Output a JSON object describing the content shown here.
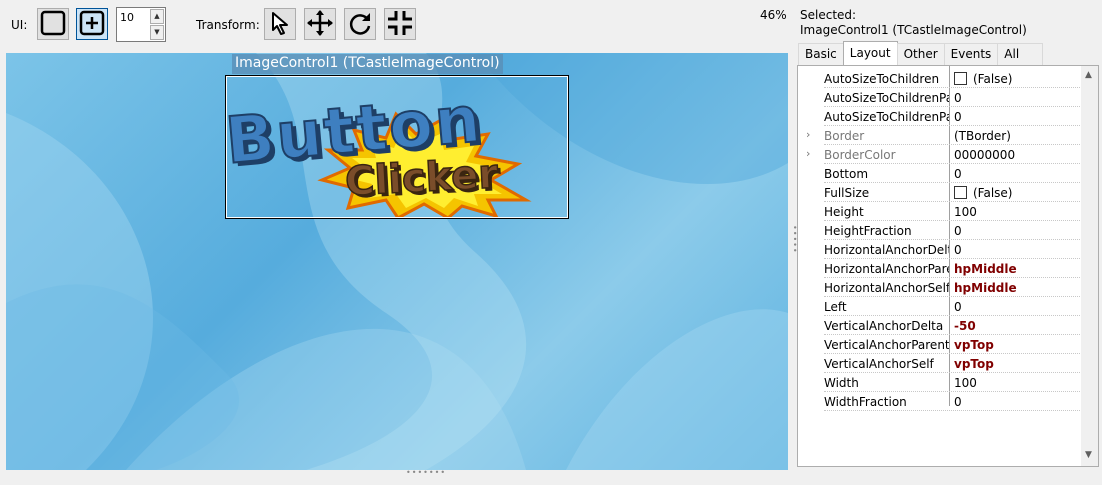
{
  "toolbar": {
    "ui_label": "UI:",
    "spin_value": "10",
    "transform_label": "Transform:",
    "zoom": "46%"
  },
  "viewport": {
    "selection_caption": "ImageControl1 (TCastleImageControl)",
    "image_line1": "Button",
    "image_line2": "Clicker"
  },
  "inspector": {
    "selected_label": "Selected:",
    "selected_value": "ImageControl1 (TCastleImageControl)",
    "tabs": [
      "Basic",
      "Layout",
      "Other",
      "Events",
      "All"
    ],
    "active_tab": "Layout",
    "properties": [
      {
        "name": "AutoSizeToChildren",
        "value": "(False)",
        "checkbox": true
      },
      {
        "name": "AutoSizeToChildrenPaddingRight",
        "value": "0"
      },
      {
        "name": "AutoSizeToChildrenPaddingTop",
        "value": "0"
      },
      {
        "name": "Border",
        "value": "(TBorder)",
        "expandable": true
      },
      {
        "name": "BorderColor",
        "value": "00000000",
        "expandable": true
      },
      {
        "name": "Bottom",
        "value": "0"
      },
      {
        "name": "FullSize",
        "value": "(False)",
        "checkbox": true
      },
      {
        "name": "Height",
        "value": "100"
      },
      {
        "name": "HeightFraction",
        "value": "0"
      },
      {
        "name": "HorizontalAnchorDelta",
        "value": "0"
      },
      {
        "name": "HorizontalAnchorParent",
        "value": "hpMiddle",
        "modified": true
      },
      {
        "name": "HorizontalAnchorSelf",
        "value": "hpMiddle",
        "modified": true
      },
      {
        "name": "Left",
        "value": "0"
      },
      {
        "name": "VerticalAnchorDelta",
        "value": "-50",
        "modified": true
      },
      {
        "name": "VerticalAnchorParent",
        "value": "vpTop",
        "modified": true
      },
      {
        "name": "VerticalAnchorSelf",
        "value": "vpTop",
        "modified": true
      },
      {
        "name": "Width",
        "value": "100"
      },
      {
        "name": "WidthFraction",
        "value": "0"
      }
    ]
  },
  "colors": {
    "modified_value": "#800000",
    "active_tool": "#cce4f7"
  }
}
